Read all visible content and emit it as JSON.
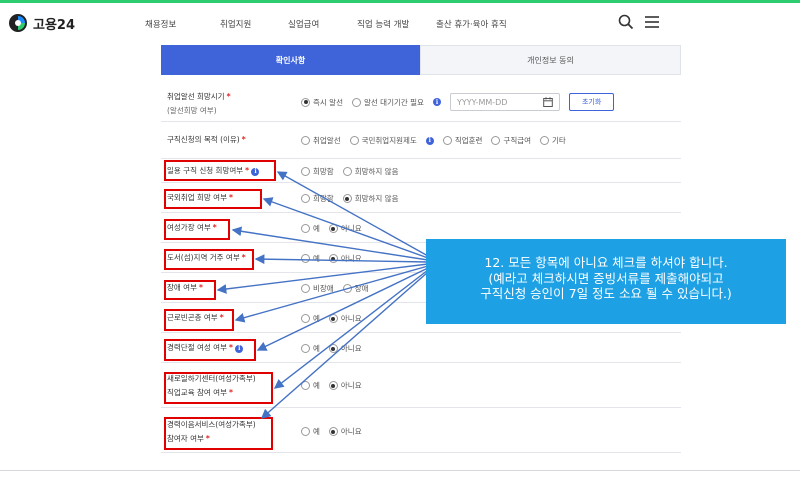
{
  "brand": {
    "logo_text": "고용24"
  },
  "nav": [
    "채용정보",
    "취업지원",
    "실업급여",
    "직업 능력 개발",
    "출산 휴가·육아 휴직"
  ],
  "header_icons": [
    "search-icon",
    "menu-icon"
  ],
  "tabs": {
    "active": "확인사항",
    "inactive": "개인정보 동의"
  },
  "form": {
    "r1": {
      "label": "취업알선 희망시기",
      "sub": "(알선희망 여부)",
      "opt1": "즉시 알선",
      "opt2": "알선 대기기간 필요",
      "date_placeholder": "YYYY-MM-DD",
      "reset": "초기화"
    },
    "r2": {
      "label": "구직신청의 목적 (이유)",
      "options": [
        "취업알선",
        "국민취업지원제도",
        "직업훈련",
        "구직급여",
        "기타"
      ]
    },
    "r3": {
      "label": "일용 구직 신청 희망여부",
      "opt1": "희망함",
      "opt2": "희망하지 않음"
    },
    "r4": {
      "label": "국외취업 희망 여부",
      "opt1": "희망함",
      "opt2": "희망하지 않음"
    },
    "r5": {
      "label": "여성가장 여부",
      "opt1": "예",
      "opt2": "아니요"
    },
    "r6": {
      "label": "도서(섬)지역 거주 여부",
      "opt1": "예",
      "opt2": "아니요"
    },
    "r7": {
      "label": "장애 여부",
      "opt1": "비장애",
      "opt2": "장애"
    },
    "r8": {
      "label": "근로빈곤층 여부",
      "opt1": "예",
      "opt2": "아니요"
    },
    "r9": {
      "label": "경력단절 여성 여부",
      "opt1": "예",
      "opt2": "아니요"
    },
    "r10": {
      "label": "새로일하기센터(여성가족부)",
      "label2": "직업교육 참여 여부",
      "opt1": "예",
      "opt2": "아니요"
    },
    "r11": {
      "label": "경력이음서비스(여성가족부)",
      "label2": "참여자 여부",
      "opt1": "예",
      "opt2": "아니요"
    }
  },
  "callout": {
    "line1": "12. 모든 항목에 아니요 체크를 하셔야 합니다.",
    "line2": "(예라고 체크하시면 증빙서류를 제출해야되고",
    "line3": "구직신청 승인이 7일 정도 소요 될 수 있습니다.)"
  },
  "colors": {
    "accent": "#3f63d9",
    "highlight": "#e00000",
    "callout_bg": "#1da0e4",
    "topline": "#2ecc71"
  }
}
